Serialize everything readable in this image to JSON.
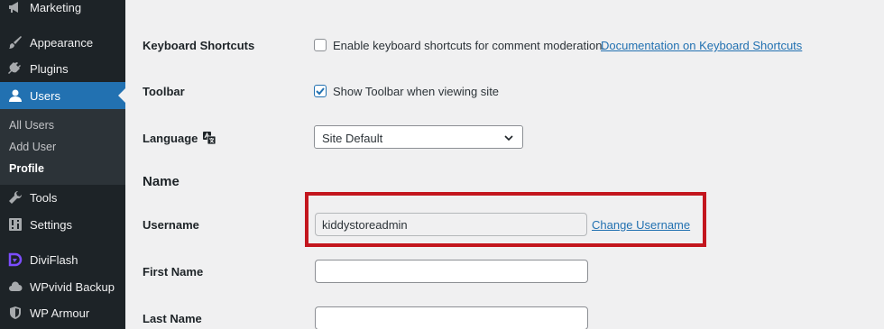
{
  "sidebar": {
    "items": [
      {
        "label": "Marketing",
        "icon": "megaphone-icon"
      },
      {
        "label": "Appearance",
        "icon": "paintbrush-icon"
      },
      {
        "label": "Plugins",
        "icon": "plug-icon"
      },
      {
        "label": "Users",
        "icon": "user-icon",
        "active": true
      },
      {
        "label": "Tools",
        "icon": "wrench-icon"
      },
      {
        "label": "Settings",
        "icon": "settings-icon"
      },
      {
        "label": "DiviFlash",
        "icon": "diviflash-icon"
      },
      {
        "label": "WPvivid Backup",
        "icon": "cloud-icon"
      },
      {
        "label": "WP Armour",
        "icon": "shield-icon"
      }
    ],
    "submenu": [
      {
        "label": "All Users"
      },
      {
        "label": "Add User"
      },
      {
        "label": "Profile",
        "current": true
      }
    ]
  },
  "main": {
    "keyboard_shortcuts": {
      "label": "Keyboard Shortcuts",
      "checkbox_text": "Enable keyboard shortcuts for comment moderation.",
      "checked": false,
      "link": "Documentation on Keyboard Shortcuts"
    },
    "toolbar": {
      "label": "Toolbar",
      "checkbox_text": "Show Toolbar when viewing site",
      "checked": true
    },
    "language": {
      "label": "Language",
      "selected": "Site Default"
    },
    "name_section_title": "Name",
    "username": {
      "label": "Username",
      "value": "kiddystoreadmin",
      "change_link": "Change Username"
    },
    "first_name": {
      "label": "First Name",
      "value": ""
    },
    "last_name": {
      "label": "Last Name",
      "value": ""
    }
  },
  "colors": {
    "sidebar_bg": "#1d2327",
    "active_bg": "#2271b1",
    "link": "#2271b1",
    "highlight": "#c3161e"
  }
}
